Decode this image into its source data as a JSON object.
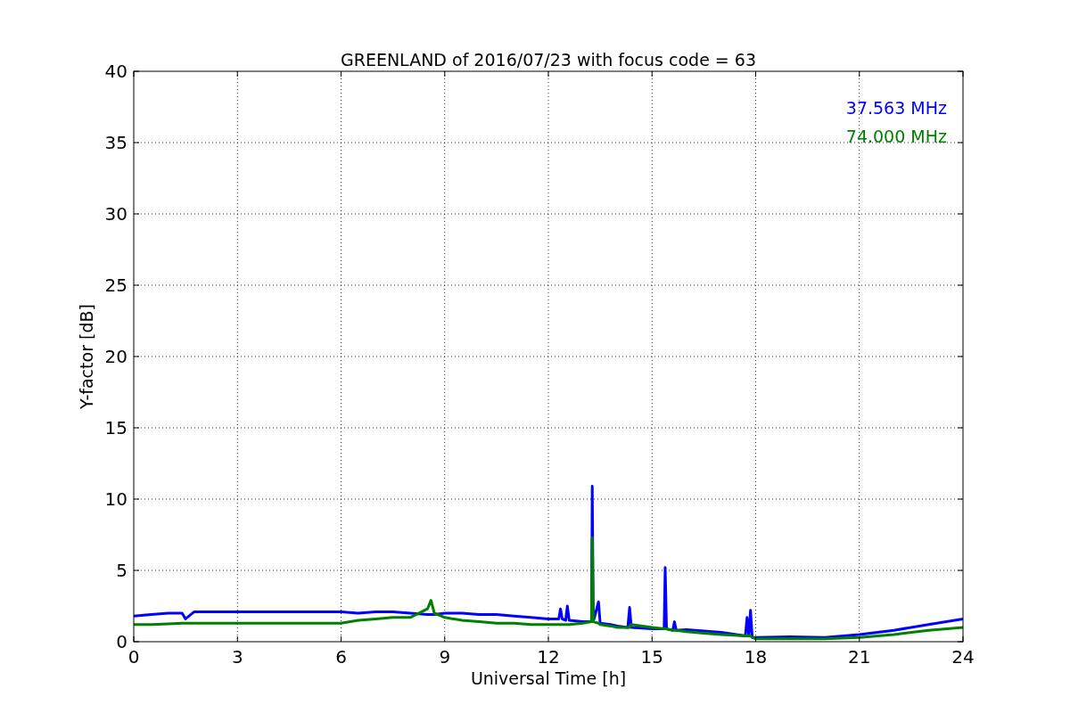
{
  "chart_data": {
    "type": "line",
    "title": "GREENLAND of 2016/07/23 with focus code = 63",
    "xlabel": "Universal Time [h]",
    "ylabel": "Y-factor [dB]",
    "x": [
      0,
      0.5,
      1,
      1.4,
      1.5,
      1.75,
      6,
      6.5,
      7,
      7.5,
      8,
      8.5,
      8.6,
      8.7,
      9,
      9.5,
      10,
      10.5,
      11,
      11.5,
      12,
      12.3,
      12.35,
      12.4,
      12.5,
      12.55,
      12.6,
      13,
      13.25,
      13.27,
      13.3,
      13.45,
      13.5,
      13.8,
      14,
      14.3,
      14.35,
      14.4,
      15,
      15.35,
      15.38,
      15.42,
      15.6,
      15.65,
      15.7,
      16,
      16.5,
      17,
      17.7,
      17.75,
      17.8,
      17.85,
      17.9,
      18,
      19,
      20,
      21,
      22,
      23,
      24
    ],
    "series": [
      {
        "name": "37.563 MHz",
        "color": "#0000ff",
        "values": [
          1.8,
          1.9,
          2.0,
          2.0,
          1.6,
          2.1,
          2.1,
          2.0,
          2.1,
          2.1,
          2.0,
          1.9,
          1.9,
          1.9,
          2.0,
          2.0,
          1.9,
          1.9,
          1.8,
          1.7,
          1.6,
          1.6,
          2.3,
          1.6,
          1.5,
          2.5,
          1.5,
          1.4,
          1.4,
          10.9,
          1.4,
          2.8,
          1.3,
          1.2,
          1.1,
          1.0,
          2.4,
          1.0,
          0.9,
          0.9,
          5.2,
          0.9,
          0.8,
          1.4,
          0.8,
          0.85,
          0.75,
          0.65,
          0.4,
          1.7,
          0.4,
          2.2,
          0.3,
          0.3,
          0.35,
          0.3,
          0.5,
          0.8,
          1.2,
          1.6
        ]
      },
      {
        "name": "74.000 MHz",
        "color": "#008000",
        "values": [
          1.2,
          1.2,
          1.25,
          1.3,
          1.3,
          1.3,
          1.3,
          1.5,
          1.6,
          1.7,
          1.7,
          2.3,
          2.9,
          2.0,
          1.7,
          1.5,
          1.4,
          1.3,
          1.3,
          1.2,
          1.2,
          1.2,
          1.2,
          1.2,
          1.2,
          1.2,
          1.2,
          1.3,
          1.4,
          7.3,
          1.4,
          1.3,
          1.2,
          1.1,
          1.0,
          1.0,
          1.0,
          1.2,
          1.0,
          0.9,
          0.9,
          0.9,
          0.8,
          0.8,
          0.8,
          0.7,
          0.6,
          0.5,
          0.4,
          0.4,
          0.4,
          0.4,
          0.3,
          0.2,
          0.2,
          0.2,
          0.3,
          0.5,
          0.8,
          1.0
        ]
      }
    ],
    "grid": true,
    "xlim": [
      0,
      24
    ],
    "ylim": [
      0,
      40
    ],
    "xticks": [
      0,
      3,
      6,
      9,
      12,
      15,
      18,
      21,
      24
    ],
    "yticks": [
      0,
      5,
      10,
      15,
      20,
      25,
      30,
      35,
      40
    ]
  }
}
